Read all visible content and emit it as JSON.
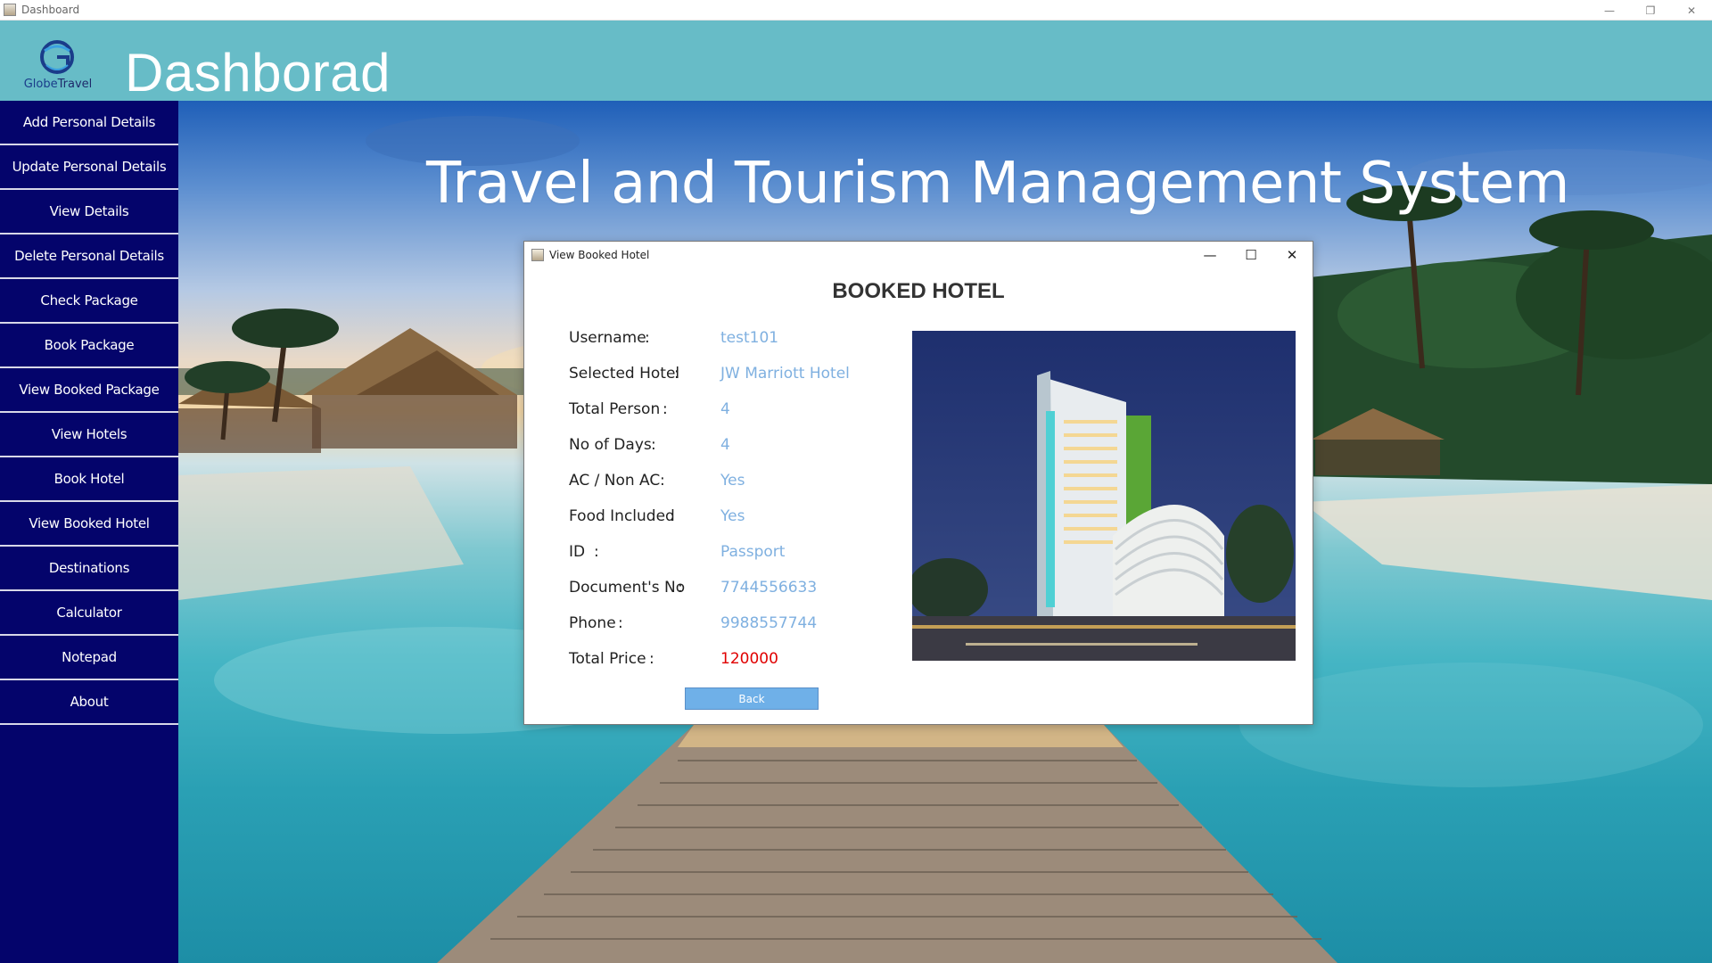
{
  "window": {
    "title": "Dashboard",
    "controls": {
      "minimize": "—",
      "restore": "❐",
      "close": "✕"
    }
  },
  "header": {
    "logo": {
      "text_part1": "Globe",
      "text_part2": "Travel",
      "icon": "globe-logo-icon"
    },
    "title": "Dashborad"
  },
  "sidebar": {
    "items": [
      {
        "label": "Add Personal Details"
      },
      {
        "label": "Update Personal Details"
      },
      {
        "label": "View Details"
      },
      {
        "label": "Delete Personal Details"
      },
      {
        "label": "Check Package"
      },
      {
        "label": "Book Package"
      },
      {
        "label": "View Booked Package"
      },
      {
        "label": "View Hotels"
      },
      {
        "label": "Book Hotel"
      },
      {
        "label": "View Booked Hotel"
      },
      {
        "label": "Destinations"
      },
      {
        "label": "Calculator"
      },
      {
        "label": "Notepad"
      },
      {
        "label": "About"
      }
    ]
  },
  "main": {
    "title": "Travel and Tourism Management System"
  },
  "dialog": {
    "title": "View Booked Hotel",
    "controls": {
      "minimize": "—",
      "maximize": "☐",
      "close": "✕"
    },
    "heading": "BOOKED HOTEL",
    "fields": [
      {
        "label": "Username",
        "colon": ":",
        "value": "test101"
      },
      {
        "label": "Selected Hotel",
        "colon": ":",
        "value": "JW Marriott Hotel"
      },
      {
        "label": "Total Person",
        "colon": ":",
        "value": "4"
      },
      {
        "label": "No of Days",
        "colon": ":",
        "value": "4"
      },
      {
        "label": "AC / Non AC",
        "colon": ":",
        "value": "Yes"
      },
      {
        "label": "Food Included",
        "colon": ":",
        "value": "Yes"
      },
      {
        "label": "ID",
        "colon": ":",
        "value": "Passport"
      },
      {
        "label": "Document's No",
        "colon": ":",
        "value": "7744556633"
      },
      {
        "label": "Phone",
        "colon": ":",
        "value": "9988557744"
      },
      {
        "label": "Total Price",
        "colon": ":",
        "value": "120000"
      }
    ],
    "back_button": "Back"
  },
  "colors": {
    "header": "#67bcc7",
    "sidebar": "#04046b",
    "value_text": "#7fb0e0",
    "price_text": "#e00000",
    "button": "#6fb0e8"
  }
}
